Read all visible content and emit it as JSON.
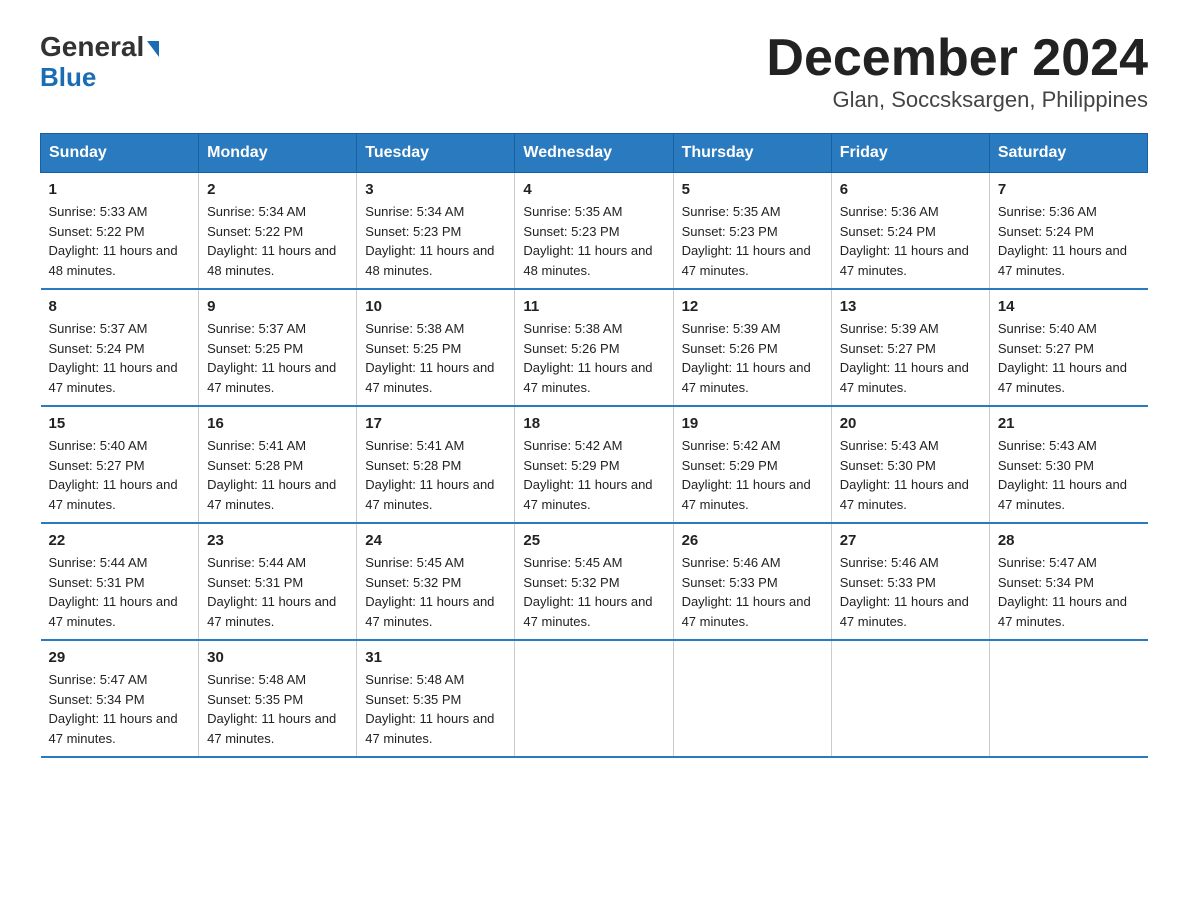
{
  "header": {
    "logo_general": "General",
    "logo_blue": "Blue",
    "month_title": "December 2024",
    "location": "Glan, Soccsksargen, Philippines"
  },
  "days_of_week": [
    "Sunday",
    "Monday",
    "Tuesday",
    "Wednesday",
    "Thursday",
    "Friday",
    "Saturday"
  ],
  "weeks": [
    [
      {
        "day": "1",
        "sunrise": "5:33 AM",
        "sunset": "5:22 PM",
        "daylight": "11 hours and 48 minutes."
      },
      {
        "day": "2",
        "sunrise": "5:34 AM",
        "sunset": "5:22 PM",
        "daylight": "11 hours and 48 minutes."
      },
      {
        "day": "3",
        "sunrise": "5:34 AM",
        "sunset": "5:23 PM",
        "daylight": "11 hours and 48 minutes."
      },
      {
        "day": "4",
        "sunrise": "5:35 AM",
        "sunset": "5:23 PM",
        "daylight": "11 hours and 48 minutes."
      },
      {
        "day": "5",
        "sunrise": "5:35 AM",
        "sunset": "5:23 PM",
        "daylight": "11 hours and 47 minutes."
      },
      {
        "day": "6",
        "sunrise": "5:36 AM",
        "sunset": "5:24 PM",
        "daylight": "11 hours and 47 minutes."
      },
      {
        "day": "7",
        "sunrise": "5:36 AM",
        "sunset": "5:24 PM",
        "daylight": "11 hours and 47 minutes."
      }
    ],
    [
      {
        "day": "8",
        "sunrise": "5:37 AM",
        "sunset": "5:24 PM",
        "daylight": "11 hours and 47 minutes."
      },
      {
        "day": "9",
        "sunrise": "5:37 AM",
        "sunset": "5:25 PM",
        "daylight": "11 hours and 47 minutes."
      },
      {
        "day": "10",
        "sunrise": "5:38 AM",
        "sunset": "5:25 PM",
        "daylight": "11 hours and 47 minutes."
      },
      {
        "day": "11",
        "sunrise": "5:38 AM",
        "sunset": "5:26 PM",
        "daylight": "11 hours and 47 minutes."
      },
      {
        "day": "12",
        "sunrise": "5:39 AM",
        "sunset": "5:26 PM",
        "daylight": "11 hours and 47 minutes."
      },
      {
        "day": "13",
        "sunrise": "5:39 AM",
        "sunset": "5:27 PM",
        "daylight": "11 hours and 47 minutes."
      },
      {
        "day": "14",
        "sunrise": "5:40 AM",
        "sunset": "5:27 PM",
        "daylight": "11 hours and 47 minutes."
      }
    ],
    [
      {
        "day": "15",
        "sunrise": "5:40 AM",
        "sunset": "5:27 PM",
        "daylight": "11 hours and 47 minutes."
      },
      {
        "day": "16",
        "sunrise": "5:41 AM",
        "sunset": "5:28 PM",
        "daylight": "11 hours and 47 minutes."
      },
      {
        "day": "17",
        "sunrise": "5:41 AM",
        "sunset": "5:28 PM",
        "daylight": "11 hours and 47 minutes."
      },
      {
        "day": "18",
        "sunrise": "5:42 AM",
        "sunset": "5:29 PM",
        "daylight": "11 hours and 47 minutes."
      },
      {
        "day": "19",
        "sunrise": "5:42 AM",
        "sunset": "5:29 PM",
        "daylight": "11 hours and 47 minutes."
      },
      {
        "day": "20",
        "sunrise": "5:43 AM",
        "sunset": "5:30 PM",
        "daylight": "11 hours and 47 minutes."
      },
      {
        "day": "21",
        "sunrise": "5:43 AM",
        "sunset": "5:30 PM",
        "daylight": "11 hours and 47 minutes."
      }
    ],
    [
      {
        "day": "22",
        "sunrise": "5:44 AM",
        "sunset": "5:31 PM",
        "daylight": "11 hours and 47 minutes."
      },
      {
        "day": "23",
        "sunrise": "5:44 AM",
        "sunset": "5:31 PM",
        "daylight": "11 hours and 47 minutes."
      },
      {
        "day": "24",
        "sunrise": "5:45 AM",
        "sunset": "5:32 PM",
        "daylight": "11 hours and 47 minutes."
      },
      {
        "day": "25",
        "sunrise": "5:45 AM",
        "sunset": "5:32 PM",
        "daylight": "11 hours and 47 minutes."
      },
      {
        "day": "26",
        "sunrise": "5:46 AM",
        "sunset": "5:33 PM",
        "daylight": "11 hours and 47 minutes."
      },
      {
        "day": "27",
        "sunrise": "5:46 AM",
        "sunset": "5:33 PM",
        "daylight": "11 hours and 47 minutes."
      },
      {
        "day": "28",
        "sunrise": "5:47 AM",
        "sunset": "5:34 PM",
        "daylight": "11 hours and 47 minutes."
      }
    ],
    [
      {
        "day": "29",
        "sunrise": "5:47 AM",
        "sunset": "5:34 PM",
        "daylight": "11 hours and 47 minutes."
      },
      {
        "day": "30",
        "sunrise": "5:48 AM",
        "sunset": "5:35 PM",
        "daylight": "11 hours and 47 minutes."
      },
      {
        "day": "31",
        "sunrise": "5:48 AM",
        "sunset": "5:35 PM",
        "daylight": "11 hours and 47 minutes."
      },
      null,
      null,
      null,
      null
    ]
  ],
  "labels": {
    "sunrise": "Sunrise:",
    "sunset": "Sunset:",
    "daylight": "Daylight:"
  }
}
